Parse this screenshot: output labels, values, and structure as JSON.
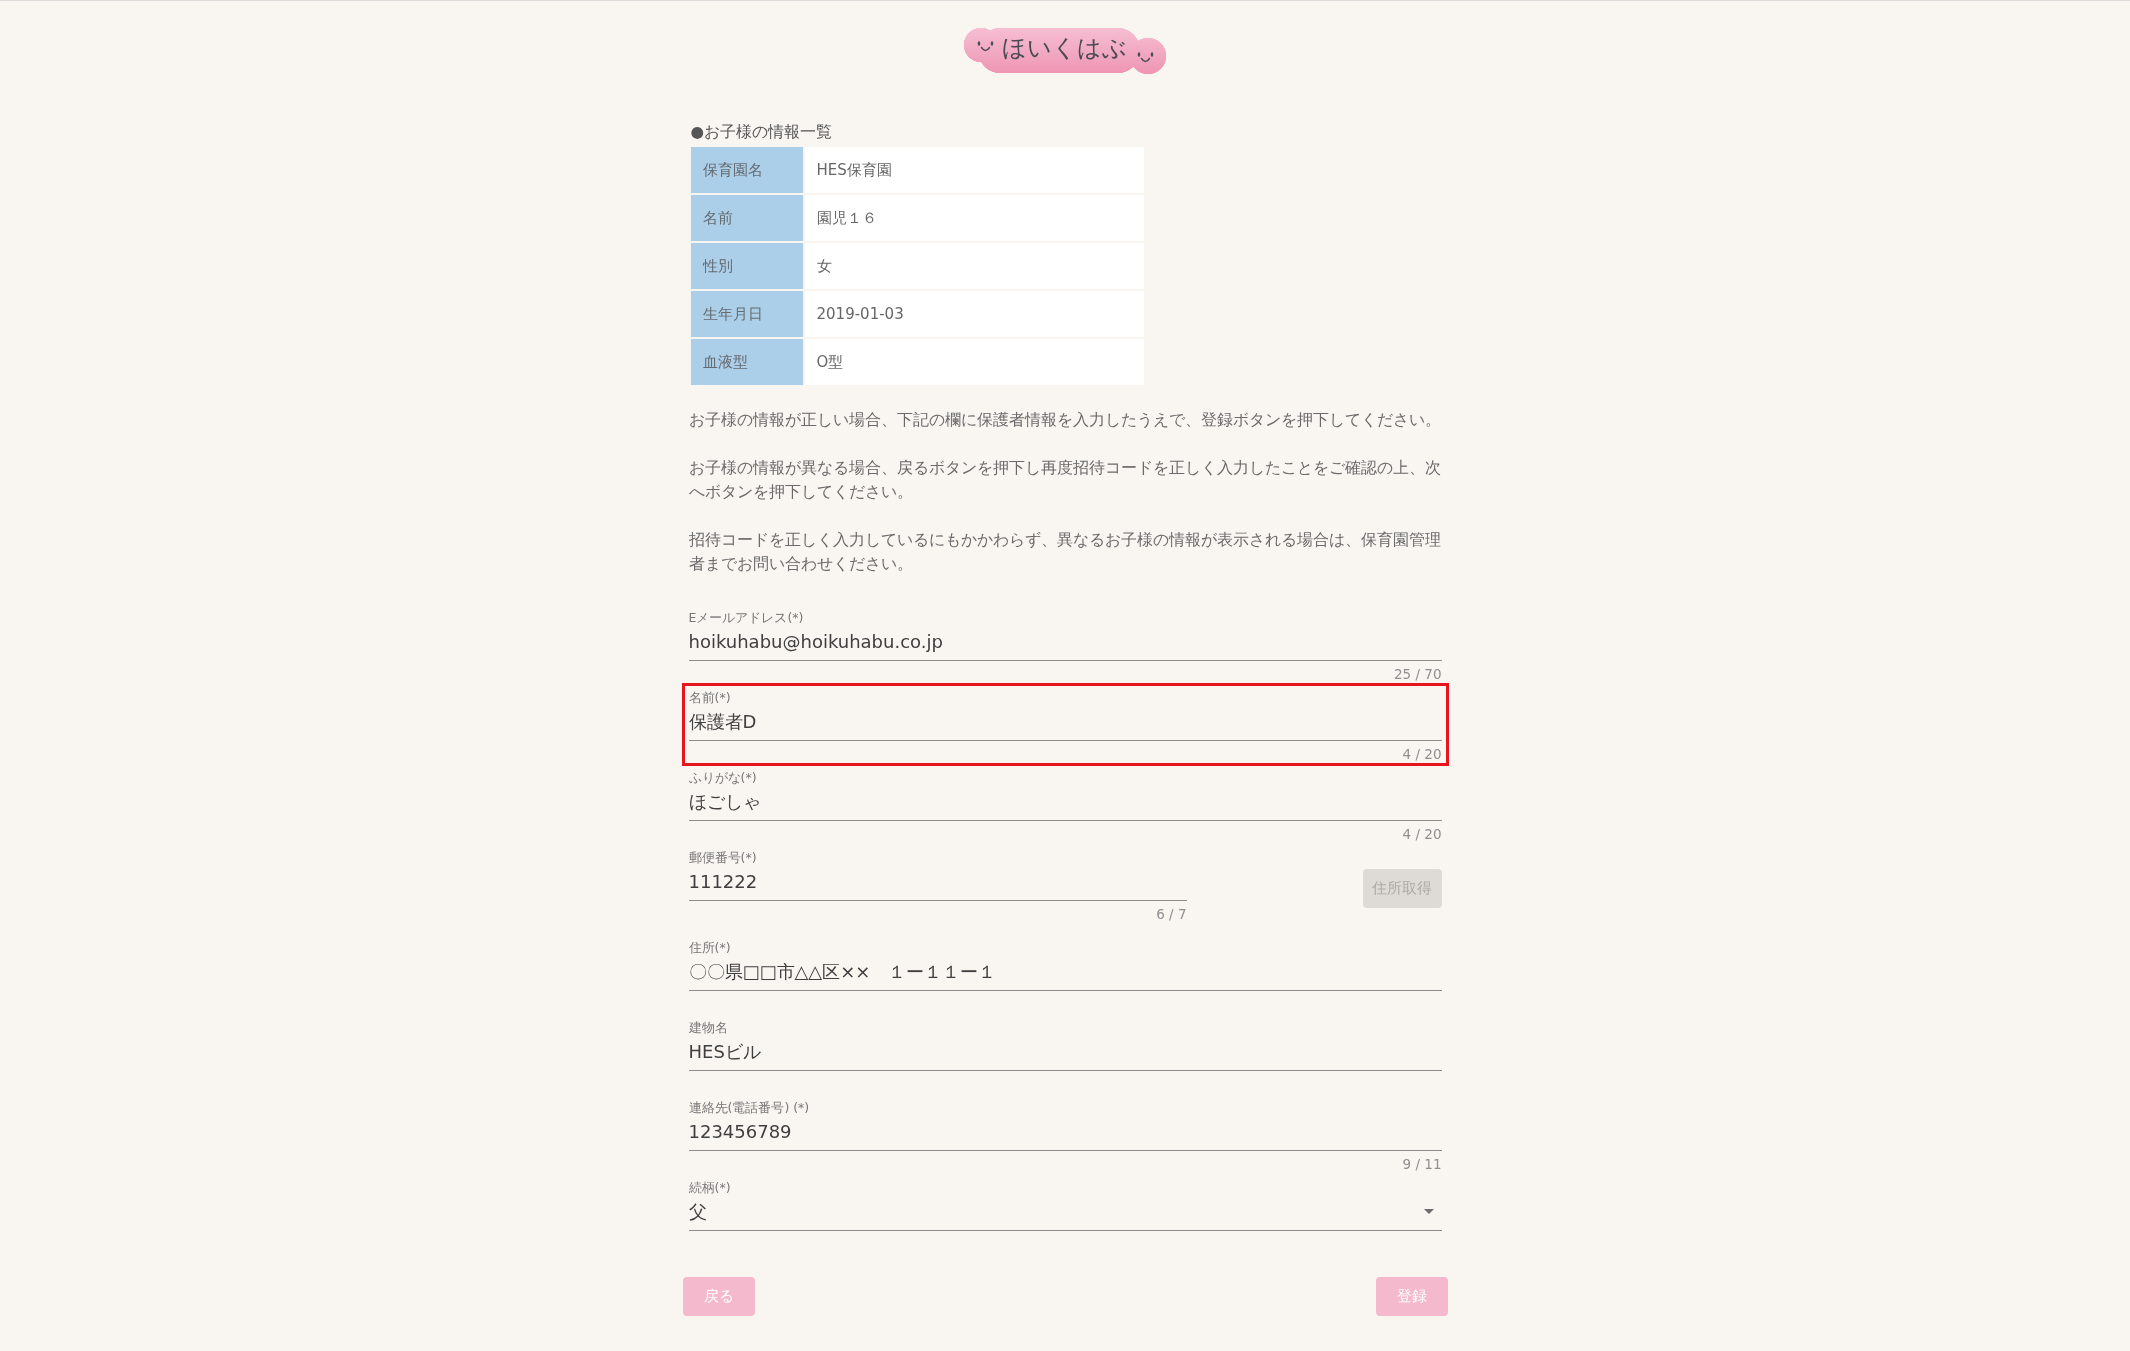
{
  "logo": {
    "text": "ほいくはぶ"
  },
  "child_info": {
    "title": "●お子様の情報一覧",
    "rows": [
      {
        "label": "保育園名",
        "value": "HES保育園"
      },
      {
        "label": "名前",
        "value": "園児１６"
      },
      {
        "label": "性別",
        "value": "女"
      },
      {
        "label": "生年月日",
        "value": "2019-01-03"
      },
      {
        "label": "血液型",
        "value": "O型"
      }
    ]
  },
  "notes": [
    "お子様の情報が正しい場合、下記の欄に保護者情報を入力したうえで、登録ボタンを押下してください。",
    "お子様の情報が異なる場合、戻るボタンを押下し再度招待コードを正しく入力したことをご確認の上、次へボタンを押下してください。",
    "招待コードを正しく入力しているにもかかわらず、異なるお子様の情報が表示される場合は、保育園管理者までお問い合わせください。"
  ],
  "fields": [
    {
      "kind": "text",
      "label": "Eメールアドレス(*)",
      "value": "hoikuhabu@hoikuhabu.co.jp",
      "counter": "25 / 70",
      "highlighted": false
    },
    {
      "kind": "text",
      "label": "名前(*)",
      "value": "保護者D",
      "counter": "4 / 20",
      "highlighted": true
    },
    {
      "kind": "text",
      "label": "ふりがな(*)",
      "value": "ほごしゃ",
      "counter": "4 / 20",
      "highlighted": false
    },
    {
      "kind": "postal",
      "label": "郵便番号(*)",
      "value": "111222",
      "counter": "6 / 7",
      "highlighted": false,
      "button": {
        "label": "住所取得",
        "disabled": true
      }
    },
    {
      "kind": "text",
      "label": "住所(*)",
      "value": "〇〇県□□市△△区××　１ー１１ー１",
      "highlighted": false
    },
    {
      "kind": "text",
      "label": "建物名",
      "value": "HESビル",
      "highlighted": false
    },
    {
      "kind": "text",
      "label": "連絡先(電話番号) (*)",
      "value": "123456789",
      "counter": "9 / 11",
      "highlighted": false
    },
    {
      "kind": "select",
      "label": "続柄(*)",
      "value": "父",
      "highlighted": false
    }
  ],
  "buttons": [
    {
      "label": "戻る"
    },
    {
      "label": "登録"
    }
  ]
}
